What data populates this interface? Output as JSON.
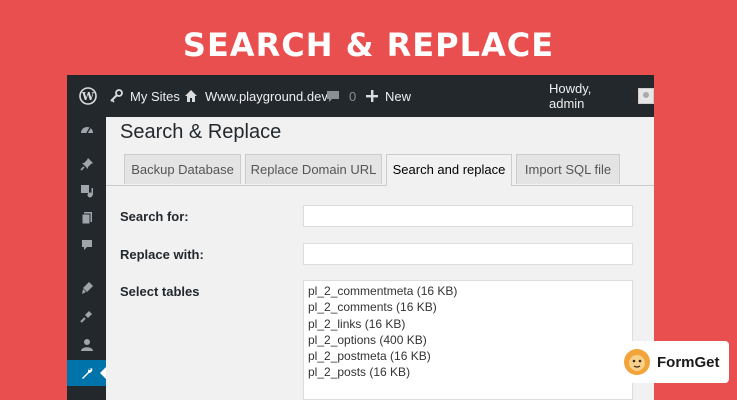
{
  "banner": {
    "title": "SEARCH & REPLACE"
  },
  "adminbar": {
    "my_sites": "My Sites",
    "site_name": "Www.playground.dev",
    "comments_count": "0",
    "new_label": "New",
    "greeting": "Howdy, admin"
  },
  "sidebar": {
    "icons": [
      "dashboard-icon",
      "pin-icon",
      "media-icon",
      "pages-icon",
      "comments-icon",
      "appearance-icon",
      "plugins-icon",
      "users-icon",
      "tools-icon"
    ],
    "active_item": "tools-icon"
  },
  "page": {
    "title": "Search & Replace",
    "tabs": [
      {
        "label": "Backup Database",
        "active": false
      },
      {
        "label": "Replace Domain URL",
        "active": false
      },
      {
        "label": "Search and replace",
        "active": true
      },
      {
        "label": "Import SQL file",
        "active": false
      }
    ],
    "search_label": "Search for:",
    "search_value": "",
    "replace_label": "Replace with:",
    "replace_value": "",
    "select_tables_label": "Select tables",
    "tables": [
      "pl_2_commentmeta (16 KB)",
      "pl_2_comments (16 KB)",
      "pl_2_links (16 KB)",
      "pl_2_options (400 KB)",
      "pl_2_postmeta (16 KB)",
      "pl_2_posts (16 KB)"
    ]
  },
  "badge": {
    "text": "FormGet"
  },
  "colors": {
    "banner_bg": "#e94f4e",
    "adminbar_bg": "#23282d",
    "sidebar_active": "#0073aa",
    "content_bg": "#f1f1f1"
  }
}
